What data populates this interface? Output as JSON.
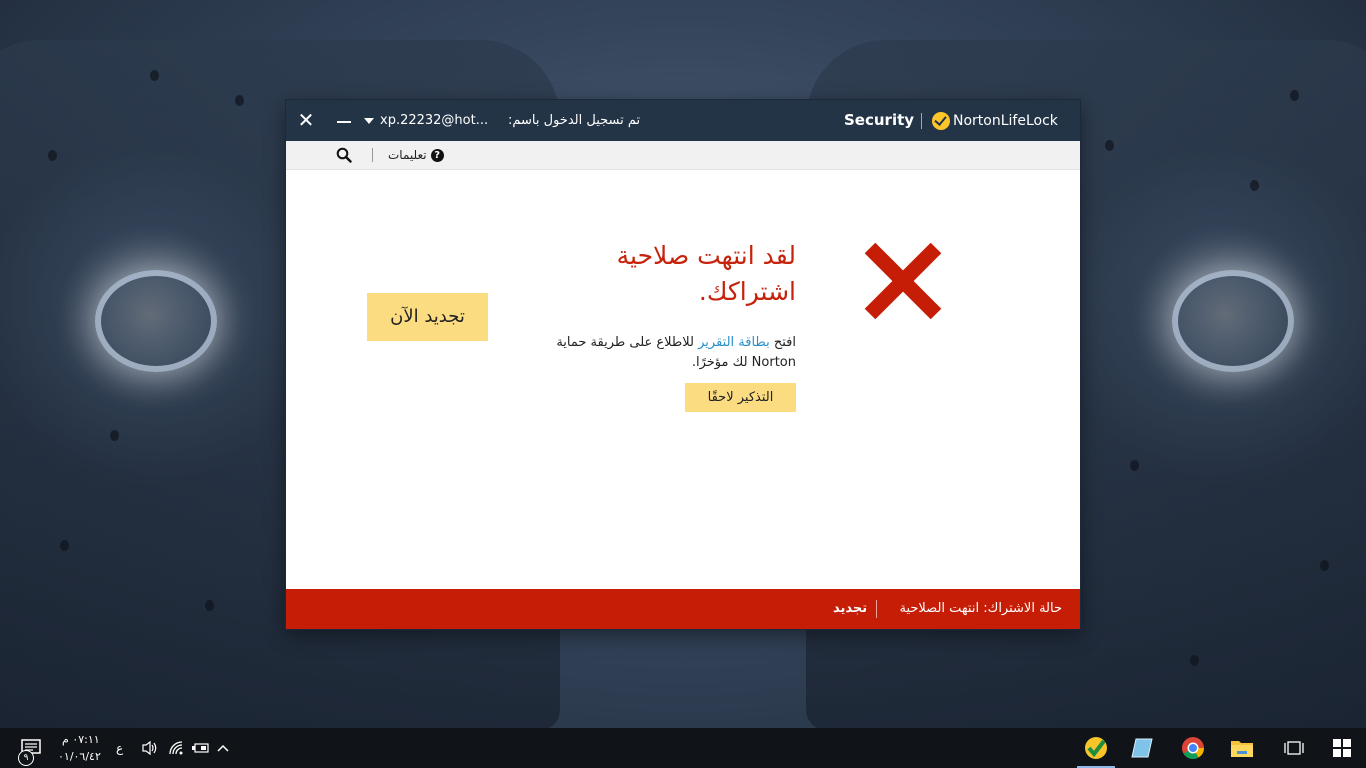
{
  "window": {
    "brand_product": "Security",
    "brand_name": "NortonLifeLock",
    "account_label": "تم تسجيل الدخول باسم:",
    "account_value": "xp.22232@hot...",
    "close_glyph": "✕"
  },
  "toolbar": {
    "help_label": "تعليمات",
    "help_glyph": "?"
  },
  "alert": {
    "headline": "لقد انتهت صلاحية اشتراكك.",
    "desc_before": "افتح ",
    "desc_link": "بطاقة التقرير",
    "desc_after": " للاطلاع على طريقة حماية Norton لك مؤخرًا.",
    "remind_later_label": "التذكير لاحقًا",
    "renew_now_label": "تجديد الآن"
  },
  "statusbar": {
    "label": "حالة الاشتراك:",
    "value": "انتهت الصلاحية",
    "renew_link": "تجديد"
  },
  "taskbar": {
    "time": "٠٧:١١ م",
    "date": "٠١/٠٦/٤٢",
    "language": "ع",
    "notification_count": "٩",
    "icons": [
      "start-icon",
      "task-view-icon",
      "file-explorer-icon",
      "chrome-icon",
      "notepad-icon",
      "norton-icon"
    ]
  },
  "colors": {
    "titlebar": "#243447",
    "accent_red": "#c61d06",
    "headline_red": "#c5230b",
    "button_yellow": "#fbdc80",
    "link_blue": "#2a8fc9"
  }
}
